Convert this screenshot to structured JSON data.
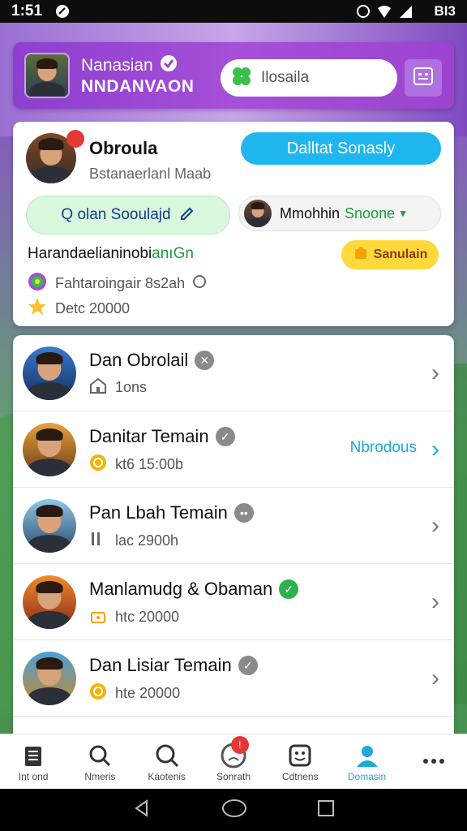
{
  "status_bar": {
    "time": "1:51",
    "right_text": "    BI3"
  },
  "header": {
    "title_line1": "Nanasian",
    "title_line2": "NNDANVAON",
    "search_placeholder": "Ilosaila"
  },
  "profile_card": {
    "name": "Obroula",
    "subtitle": "Bstanaerlanl Maab",
    "primary_button": "Dalltat Sonasly",
    "green_button": "Q olan Sooulajd",
    "user_pill_name": "Mmohhin",
    "user_pill_status": "Snoone",
    "line1_black": "Harandaelianinobi",
    "line1_green": "anıGn",
    "yellow_button": "Sanulain",
    "line2": "Fahtaroingair 8s2ah",
    "line3": "Detc 20000"
  },
  "friends": [
    {
      "name": "Dan Obrolail",
      "sub": "1ons",
      "badge": "✕",
      "badge_color": "#8a8a8a",
      "action": ""
    },
    {
      "name": "Danitar Temain",
      "sub": "kt6 15:00b",
      "badge": "✓",
      "badge_color": "#8a8a8a",
      "action": "Nbrodous"
    },
    {
      "name": "Pan Lbah Temain",
      "sub": "lac 2900h",
      "badge": "••",
      "badge_color": "#8a8a8a",
      "action": ""
    },
    {
      "name": "Manlamudg & Obaman",
      "sub": "htc 20000",
      "badge": "✓",
      "badge_color": "#2bb24c",
      "action": ""
    },
    {
      "name": "Dan Lisiar Temain",
      "sub": "hte 20000",
      "badge": "✓",
      "badge_color": "#8a8a8a",
      "action": ""
    }
  ],
  "bottom_nav": [
    {
      "label": "Int ond",
      "icon": "document-icon"
    },
    {
      "label": "Nmeris",
      "icon": "search-icon"
    },
    {
      "label": "Kaotenis",
      "icon": "magnify-icon"
    },
    {
      "label": "Sonrath",
      "icon": "frown-icon",
      "badge": "!"
    },
    {
      "label": "Cdtnens",
      "icon": "smile-icon"
    },
    {
      "label": "Domasin",
      "icon": "user-icon",
      "active": true
    },
    {
      "label": "",
      "icon": "more-icon"
    }
  ],
  "colors": {
    "accent": "#1fb6ef",
    "header": "#9a44d0",
    "green": "#1b9b3a",
    "yellow": "#ffd93b"
  }
}
